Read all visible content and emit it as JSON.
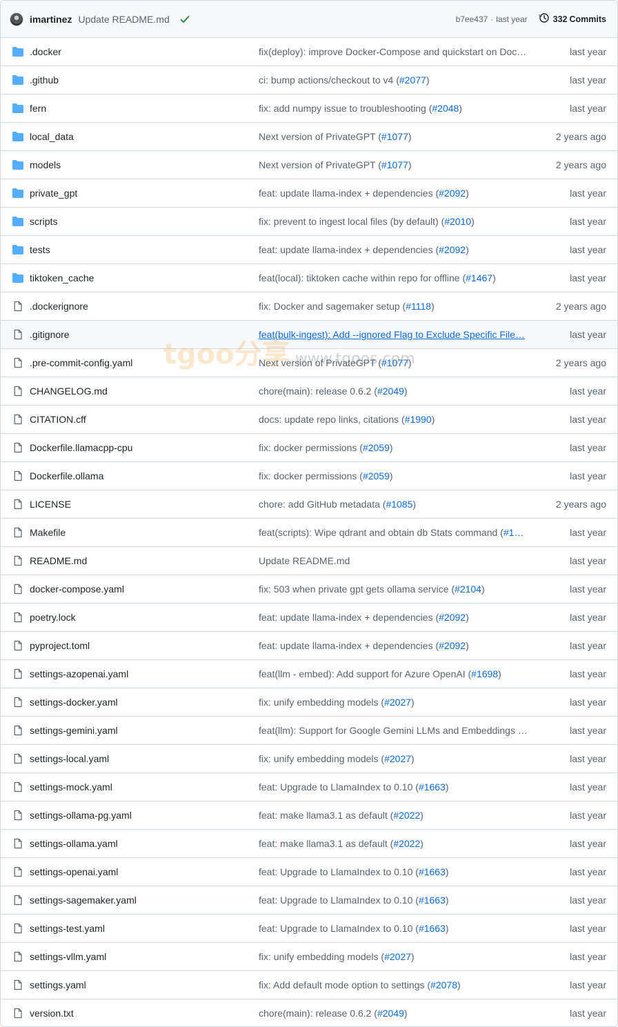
{
  "header": {
    "author": "imartinez",
    "commit_message": "Update README.md",
    "sha": "b7ee437",
    "separator": "·",
    "time": "last year",
    "commits_count": "332",
    "commits_label": "Commits"
  },
  "rows": [
    {
      "type": "folder",
      "name": ".docker",
      "message": "fix(deploy): improve Docker-Compose and quickstart on Doc…",
      "pr": "",
      "age": "last year"
    },
    {
      "type": "folder",
      "name": ".github",
      "message": "ci: bump actions/checkout to v4 (",
      "pr": "#2077",
      "tail": ")",
      "age": "last year"
    },
    {
      "type": "folder",
      "name": "fern",
      "message": "fix: add numpy issue to troubleshooting (",
      "pr": "#2048",
      "tail": ")",
      "age": "last year"
    },
    {
      "type": "folder",
      "name": "local_data",
      "message": "Next version of PrivateGPT (",
      "pr": "#1077",
      "tail": ")",
      "age": "2 years ago"
    },
    {
      "type": "folder",
      "name": "models",
      "message": "Next version of PrivateGPT (",
      "pr": "#1077",
      "tail": ")",
      "age": "2 years ago"
    },
    {
      "type": "folder",
      "name": "private_gpt",
      "message": "feat: update llama-index + dependencies (",
      "pr": "#2092",
      "tail": ")",
      "age": "last year"
    },
    {
      "type": "folder",
      "name": "scripts",
      "message": "fix: prevent to ingest local files (by default) (",
      "pr": "#2010",
      "tail": ")",
      "age": "last year"
    },
    {
      "type": "folder",
      "name": "tests",
      "message": "feat: update llama-index + dependencies (",
      "pr": "#2092",
      "tail": ")",
      "age": "last year"
    },
    {
      "type": "folder",
      "name": "tiktoken_cache",
      "message": "feat(local): tiktoken cache within repo for offline (",
      "pr": "#1467",
      "tail": ")",
      "age": "last year"
    },
    {
      "type": "file",
      "name": ".dockerignore",
      "message": "fix: Docker and sagemaker setup (",
      "pr": "#1118",
      "tail": ")",
      "age": "2 years ago"
    },
    {
      "type": "file",
      "name": ".gitignore",
      "message": "feat(bulk-ingest): Add --ignored Flag to Exclude Specific File…",
      "pr": "",
      "age": "last year",
      "hover": true
    },
    {
      "type": "file",
      "name": ".pre-commit-config.yaml",
      "message": "Next version of PrivateGPT (",
      "pr": "#1077",
      "tail": ")",
      "age": "2 years ago"
    },
    {
      "type": "file",
      "name": "CHANGELOG.md",
      "message": "chore(main): release 0.6.2 (",
      "pr": "#2049",
      "tail": ")",
      "age": "last year"
    },
    {
      "type": "file",
      "name": "CITATION.cff",
      "message": "docs: update repo links, citations (",
      "pr": "#1990",
      "tail": ")",
      "age": "last year"
    },
    {
      "type": "file",
      "name": "Dockerfile.llamacpp-cpu",
      "message": "fix: docker permissions (",
      "pr": "#2059",
      "tail": ")",
      "age": "last year"
    },
    {
      "type": "file",
      "name": "Dockerfile.ollama",
      "message": "fix: docker permissions (",
      "pr": "#2059",
      "tail": ")",
      "age": "last year"
    },
    {
      "type": "file",
      "name": "LICENSE",
      "message": "chore: add GitHub metadata (",
      "pr": "#1085",
      "tail": ")",
      "age": "2 years ago"
    },
    {
      "type": "file",
      "name": "Makefile",
      "message": "feat(scripts): Wipe qdrant and obtain db Stats command (",
      "pr": "#1…",
      "tail": "",
      "age": "last year"
    },
    {
      "type": "file",
      "name": "README.md",
      "message": "Update README.md",
      "pr": "",
      "age": "last year"
    },
    {
      "type": "file",
      "name": "docker-compose.yaml",
      "message": "fix: 503 when private gpt gets ollama service (",
      "pr": "#2104",
      "tail": ")",
      "age": "last year"
    },
    {
      "type": "file",
      "name": "poetry.lock",
      "message": "feat: update llama-index + dependencies (",
      "pr": "#2092",
      "tail": ")",
      "age": "last year"
    },
    {
      "type": "file",
      "name": "pyproject.toml",
      "message": "feat: update llama-index + dependencies (",
      "pr": "#2092",
      "tail": ")",
      "age": "last year"
    },
    {
      "type": "file",
      "name": "settings-azopenai.yaml",
      "message": "feat(llm - embed): Add support for Azure OpenAI (",
      "pr": "#1698",
      "tail": ")",
      "age": "last year"
    },
    {
      "type": "file",
      "name": "settings-docker.yaml",
      "message": "fix: unify embedding models (",
      "pr": "#2027",
      "tail": ")",
      "age": "last year"
    },
    {
      "type": "file",
      "name": "settings-gemini.yaml",
      "message": "feat(llm): Support for Google Gemini LLMs and Embeddings …",
      "pr": "",
      "age": "last year"
    },
    {
      "type": "file",
      "name": "settings-local.yaml",
      "message": "fix: unify embedding models (",
      "pr": "#2027",
      "tail": ")",
      "age": "last year"
    },
    {
      "type": "file",
      "name": "settings-mock.yaml",
      "message": "feat: Upgrade to LlamaIndex to 0.10 (",
      "pr": "#1663",
      "tail": ")",
      "age": "last year"
    },
    {
      "type": "file",
      "name": "settings-ollama-pg.yaml",
      "message": "feat: make llama3.1 as default (",
      "pr": "#2022",
      "tail": ")",
      "age": "last year"
    },
    {
      "type": "file",
      "name": "settings-ollama.yaml",
      "message": "feat: make llama3.1 as default (",
      "pr": "#2022",
      "tail": ")",
      "age": "last year"
    },
    {
      "type": "file",
      "name": "settings-openai.yaml",
      "message": "feat: Upgrade to LlamaIndex to 0.10 (",
      "pr": "#1663",
      "tail": ")",
      "age": "last year"
    },
    {
      "type": "file",
      "name": "settings-sagemaker.yaml",
      "message": "feat: Upgrade to LlamaIndex to 0.10 (",
      "pr": "#1663",
      "tail": ")",
      "age": "last year"
    },
    {
      "type": "file",
      "name": "settings-test.yaml",
      "message": "feat: Upgrade to LlamaIndex to 0.10 (",
      "pr": "#1663",
      "tail": ")",
      "age": "last year"
    },
    {
      "type": "file",
      "name": "settings-vllm.yaml",
      "message": "fix: unify embedding models (",
      "pr": "#2027",
      "tail": ")",
      "age": "last year"
    },
    {
      "type": "file",
      "name": "settings.yaml",
      "message": "fix: Add default mode option to settings (",
      "pr": "#2078",
      "tail": ")",
      "age": "last year"
    },
    {
      "type": "file",
      "name": "version.txt",
      "message": "chore(main): release 0.6.2 (",
      "pr": "#2049",
      "tail": ")",
      "age": "last year"
    }
  ],
  "watermark": {
    "brand": "tgoo分享",
    "url": "www.tgoos.com"
  },
  "colors": {
    "folder": "#54aeff",
    "file": "#59636e",
    "link": "#0969da",
    "success": "#1a7f37"
  }
}
